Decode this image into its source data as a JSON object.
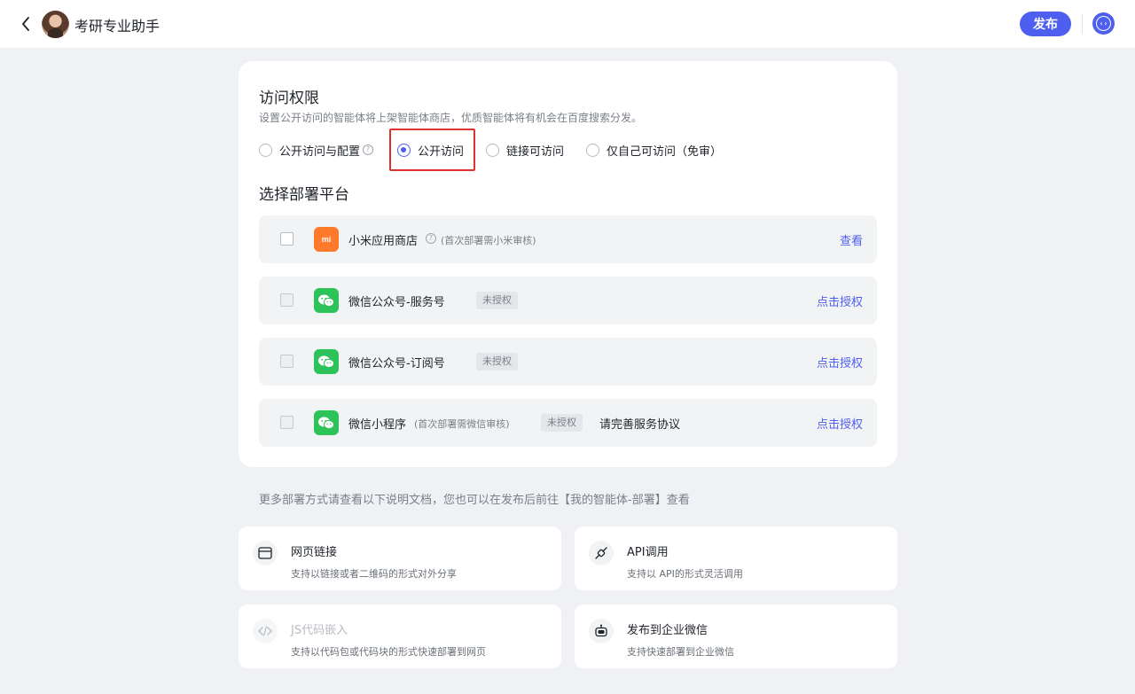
{
  "header": {
    "app_name": "考研专业助手",
    "publish_label": "发布",
    "back_icon": "chevron-left-icon",
    "code_icon": "code-icon"
  },
  "access": {
    "title": "访问权限",
    "description": "设置公开访问的智能体将上架智能体商店，优质智能体将有机会在百度搜索分发。",
    "options": [
      {
        "label": "公开访问与配置",
        "checked": false,
        "has_help": true
      },
      {
        "label": "公开访问",
        "checked": true
      },
      {
        "label": "链接可访问",
        "checked": false
      },
      {
        "label": "仅自己可访问（免审）",
        "checked": false
      }
    ],
    "highlight_color": "#e0342a"
  },
  "platforms": {
    "title": "选择部署平台",
    "items": [
      {
        "icon": "xiaomi-icon",
        "icon_text": "mi",
        "name": "小米应用商店",
        "has_help": true,
        "note": "(首次部署需小米审核)",
        "badge": "",
        "extra": "",
        "action": "查看"
      },
      {
        "icon": "wechat-icon",
        "name": "微信公众号-服务号",
        "note": "",
        "badge": "未授权",
        "extra": "",
        "action": "点击授权"
      },
      {
        "icon": "wechat-icon",
        "name": "微信公众号-订阅号",
        "note": "",
        "badge": "未授权",
        "extra": "",
        "action": "点击授权"
      },
      {
        "icon": "wechat-icon",
        "name": "微信小程序",
        "note": "(首次部署需微信审核)",
        "badge": "未授权",
        "extra": "请完善服务协议",
        "action": "点击授权"
      }
    ]
  },
  "more_text": "更多部署方式请查看以下说明文档，您也可以在发布后前往【我的智能体-部署】查看",
  "methods": [
    {
      "icon": "web-link-icon",
      "title": "网页链接",
      "desc": "支持以链接或者二维码的形式对外分享",
      "disabled": false
    },
    {
      "icon": "api-plug-icon",
      "title": "API调用",
      "desc": "支持以 API的形式灵活调用",
      "disabled": false
    },
    {
      "icon": "code-embed-icon",
      "title": "JS代码嵌入",
      "desc": "支持以代码包或代码块的形式快速部署到网页",
      "disabled": true
    },
    {
      "icon": "robot-icon",
      "title": "发布到企业微信",
      "desc": "支持快速部署到企业微信",
      "disabled": false
    }
  ],
  "colors": {
    "accent": "#4e5ff0",
    "page_bg": "#f0f1f5",
    "xiaomi": "#ff7a2b",
    "wechat": "#2ec35a"
  }
}
